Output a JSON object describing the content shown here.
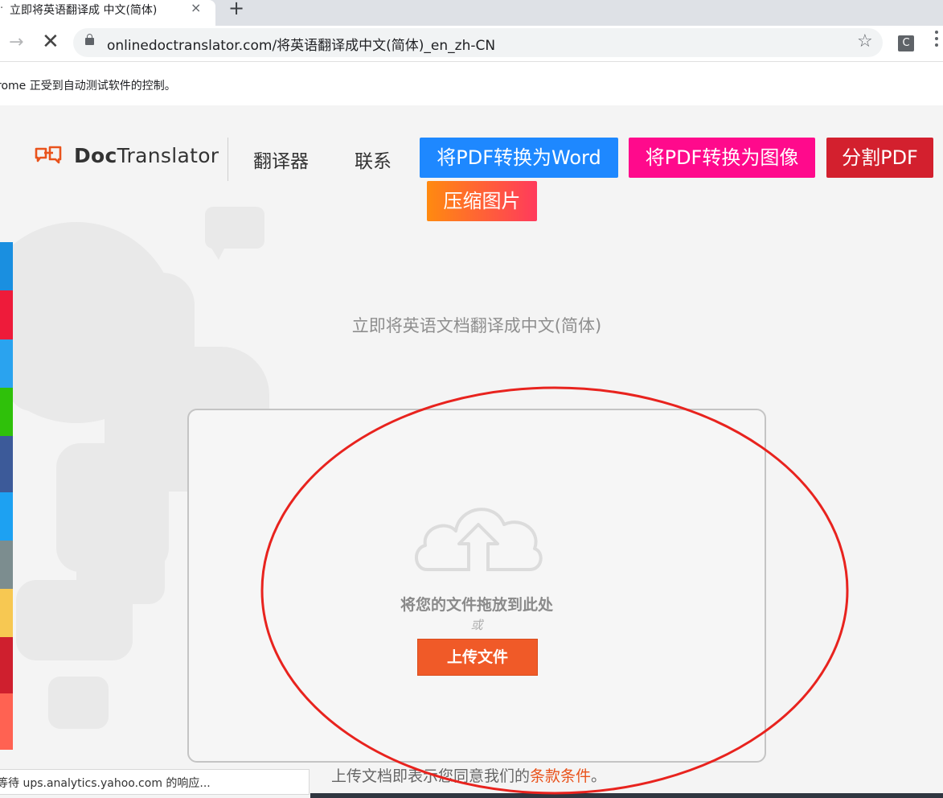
{
  "browser": {
    "tab_bullet": "·",
    "tab_title": "立即将英语翻译成 中文(简体)",
    "tab_close": "×",
    "new_tab": "+",
    "url": "onlinedoctranslator.com/将英语翻译成中文(简体)_en_zh-CN",
    "extension_label": "C",
    "infobar_text": "rome 正受到自动测试软件的控制。",
    "status_text": "等待 ups.analytics.yahoo.com 的响应..."
  },
  "header": {
    "logo_bold": "Doc",
    "logo_rest": "Translator",
    "nav": [
      {
        "label": "翻译器"
      },
      {
        "label": "联系"
      }
    ],
    "buttons": [
      {
        "label": "将PDF转换为Word",
        "color": "#1e88ff"
      },
      {
        "label": "将PDF转换为图像",
        "color": "#ff0a8c"
      },
      {
        "label": "分割PDF",
        "color": "#d3202e"
      },
      {
        "label": "压缩图片",
        "color": "#ff4a4a"
      }
    ]
  },
  "share_bar_colors": [
    "#1a8fe0",
    "#ee1b3a",
    "#2aa3ef",
    "#2fc10a",
    "#3c5a99",
    "#1da1f2",
    "#7c8d8f",
    "#f7c852",
    "#cf1f2e",
    "#ff6252"
  ],
  "main": {
    "subtitle": "立即将英语文档翻译成中文(简体)",
    "drop_text": "将您的文件拖放到此处",
    "or_text": "或",
    "upload_label": "上传文件",
    "terms_prefix": "上传文档即表示您同意我们的",
    "terms_link": "条款条件",
    "terms_suffix": "。"
  },
  "colors": {
    "accent_orange": "#f05a28",
    "annotation_red": "#e8231e"
  }
}
